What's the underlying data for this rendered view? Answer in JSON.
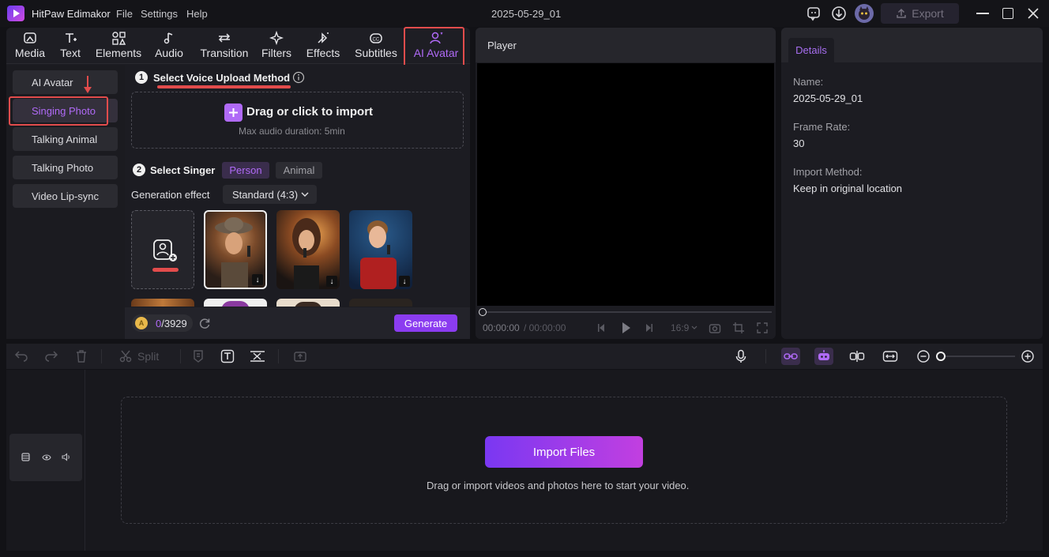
{
  "app": {
    "name": "HitPaw Edimakor",
    "menu": [
      "File",
      "Settings",
      "Help"
    ],
    "project_title": "2025-05-29_01",
    "export_label": "Export"
  },
  "tabs": [
    {
      "label": "Media",
      "icon": "media-icon"
    },
    {
      "label": "Text",
      "icon": "text-icon"
    },
    {
      "label": "Elements",
      "icon": "elements-icon"
    },
    {
      "label": "Audio",
      "icon": "audio-icon"
    },
    {
      "label": "Transition",
      "icon": "transition-icon"
    },
    {
      "label": "Filters",
      "icon": "filters-icon"
    },
    {
      "label": "Effects",
      "icon": "effects-icon"
    },
    {
      "label": "Subtitles",
      "icon": "subtitles-icon"
    },
    {
      "label": "AI Avatar",
      "icon": "ai-avatar-icon",
      "active": true
    }
  ],
  "subnav": [
    {
      "label": "AI Avatar"
    },
    {
      "label": "Singing Photo",
      "active": true
    },
    {
      "label": "Talking Animal"
    },
    {
      "label": "Talking Photo"
    },
    {
      "label": "Video Lip-sync"
    }
  ],
  "step1": {
    "number": "1",
    "title": "Select Voice Upload Method",
    "drop_label": "Drag or click to import",
    "drop_hint": "Max audio duration: 5min"
  },
  "step2": {
    "number": "2",
    "title": "Select Singer",
    "options": [
      "Person",
      "Animal"
    ],
    "selected": "Person"
  },
  "generation": {
    "label": "Generation effect",
    "value": "Standard (4:3)"
  },
  "credits": {
    "used": "0",
    "total": "/3929"
  },
  "generate_label": "Generate",
  "player": {
    "title": "Player",
    "current": "00:00:00",
    "total": "/ 00:00:00",
    "ratio": "16:9"
  },
  "details": {
    "tab": "Details",
    "fields": [
      {
        "label": "Name:",
        "value": "2025-05-29_01"
      },
      {
        "label": "Frame Rate:",
        "value": "30"
      },
      {
        "label": "Import Method:",
        "value": "Keep in original location"
      }
    ]
  },
  "timeline": {
    "split_label": "Split",
    "import_label": "Import Files",
    "drop_hint": "Drag or import videos and photos here to start your video."
  },
  "colors": {
    "accent": "#b06af7",
    "highlight": "#e24c4c",
    "generate": "#8b3cf0"
  }
}
